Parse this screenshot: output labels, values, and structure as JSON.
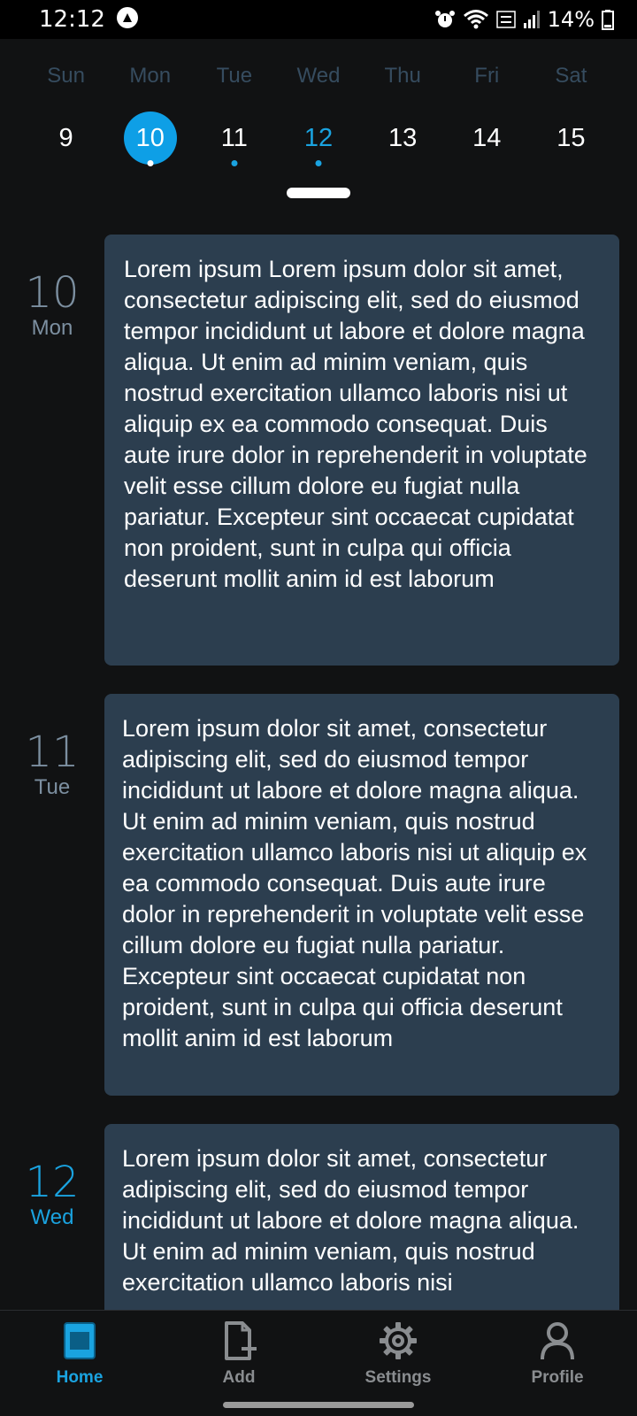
{
  "status_bar": {
    "time": "12:12",
    "battery": "14%"
  },
  "week": {
    "days": [
      {
        "name": "Sun",
        "num": "9",
        "selected": false,
        "dot": false,
        "highlight": false
      },
      {
        "name": "Mon",
        "num": "10",
        "selected": true,
        "dot": true,
        "highlight": false
      },
      {
        "name": "Tue",
        "num": "11",
        "selected": false,
        "dot": true,
        "highlight": false
      },
      {
        "name": "Wed",
        "num": "12",
        "selected": false,
        "dot": true,
        "highlight": true
      },
      {
        "name": "Thu",
        "num": "13",
        "selected": false,
        "dot": false,
        "highlight": false
      },
      {
        "name": "Fri",
        "num": "14",
        "selected": false,
        "dot": false,
        "highlight": false
      },
      {
        "name": "Sat",
        "num": "15",
        "selected": false,
        "dot": false,
        "highlight": false
      }
    ]
  },
  "entries": [
    {
      "day": "10",
      "dow": "Mon",
      "text": "Lorem ipsum Lorem ipsum dolor sit amet, consectetur adipiscing elit, sed do eiusmod tempor incididunt ut labore et dolore magna aliqua. Ut enim ad minim veniam, quis nostrud exercitation ullamco laboris nisi ut aliquip ex ea commodo consequat. Duis aute irure dolor in reprehenderit in voluptate velit esse cillum dolore eu fugiat nulla pariatur. Excepteur sint occaecat cupidatat non proident, sunt in culpa qui officia deserunt mollit anim id est laborum"
    },
    {
      "day": "11",
      "dow": "Tue",
      "text": "Lorem ipsum dolor sit amet, consectetur adipiscing elit, sed do eiusmod tempor incididunt ut labore et dolore magna aliqua. Ut enim ad minim veniam, quis nostrud exercitation ullamco laboris nisi ut aliquip ex ea commodo consequat. Duis aute irure dolor in reprehenderit in voluptate velit esse cillum dolore eu fugiat nulla pariatur. Excepteur sint occaecat cupidatat non proident, sunt in culpa qui officia deserunt mollit anim id est laborum"
    },
    {
      "day": "12",
      "dow": "Wed",
      "text": "Lorem ipsum dolor sit amet, consectetur adipiscing elit, sed do eiusmod tempor incididunt ut labore et dolore magna aliqua. Ut enim ad minim veniam, quis nostrud exercitation ullamco laboris nisi"
    }
  ],
  "nav": {
    "items": [
      {
        "label": "Home",
        "icon": "journal-icon",
        "active": true
      },
      {
        "label": "Add",
        "icon": "add-file-icon",
        "active": false
      },
      {
        "label": "Settings",
        "icon": "gear-icon",
        "active": false
      },
      {
        "label": "Profile",
        "icon": "person-icon",
        "active": false
      }
    ]
  },
  "colors": {
    "accent": "#1aa3e0",
    "card": "#2c3e4f",
    "background": "#111213"
  }
}
